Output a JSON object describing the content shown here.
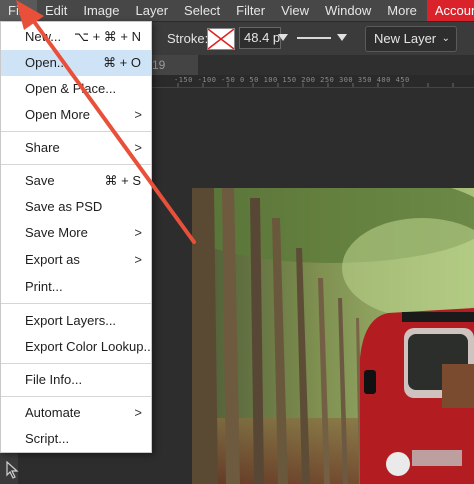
{
  "menubar": {
    "items": [
      "File",
      "Edit",
      "Image",
      "Layer",
      "Select",
      "Filter",
      "View",
      "Window",
      "More"
    ],
    "account_label": "Account"
  },
  "options": {
    "stroke_label": "Stroke:",
    "stroke_width": "48.4 p",
    "layer_mode": "New Layer"
  },
  "tab": {
    "fragment": "19"
  },
  "ruler": {
    "labels": "-150 -100 -50 0 50 100 150 200 250 300 350 400 450"
  },
  "file_menu": {
    "items": [
      {
        "label": "New...",
        "shortcut": "⌥ + ⌘ + N"
      },
      {
        "label": "Open...",
        "shortcut": "⌘ + O"
      },
      {
        "label": "Open & Place..."
      },
      {
        "label": "Open More",
        "submenu": ">"
      },
      {
        "label": "Share",
        "submenu": ">"
      },
      {
        "label": "Save",
        "shortcut": "⌘ + S"
      },
      {
        "label": "Save as PSD"
      },
      {
        "label": "Save More",
        "submenu": ">"
      },
      {
        "label": "Export as",
        "submenu": ">"
      },
      {
        "label": "Print..."
      },
      {
        "label": "Export Layers..."
      },
      {
        "label": "Export Color Lookup..."
      },
      {
        "label": "File Info..."
      },
      {
        "label": "Automate",
        "submenu": ">"
      },
      {
        "label": "Script..."
      }
    ]
  },
  "colors": {
    "account": "#d9222a",
    "arrow": "#e8503a",
    "hover": "#cfe3f7"
  },
  "icons": {
    "stroke_swatch": "no-stroke-icon",
    "pointer": "cursor-icon"
  }
}
